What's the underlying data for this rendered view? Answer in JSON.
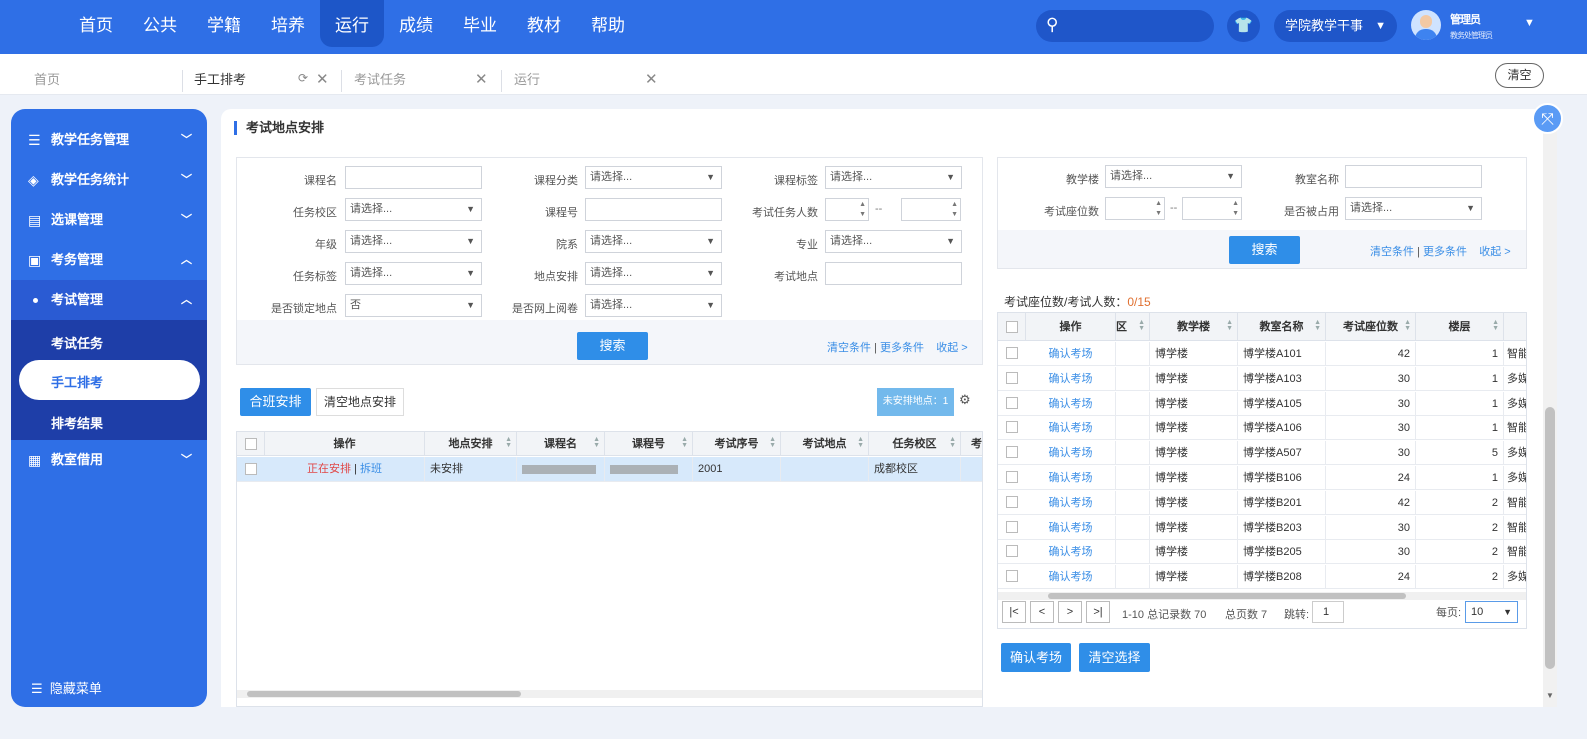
{
  "nav": [
    "首页",
    "公共",
    "学籍",
    "培养",
    "运行",
    "成绩",
    "毕业",
    "教材",
    "帮助"
  ],
  "header": {
    "role": "学院教学干事",
    "user_name": "管理员",
    "user_dept": "教务处管理员"
  },
  "tabs": {
    "t1": "首页",
    "t2": "手工排考",
    "t3": "考试任务",
    "t4": "运行",
    "clear": "清空"
  },
  "sidebar": {
    "m1": "教学任务管理",
    "m2": "教学任务统计",
    "m3": "选课管理",
    "m4": "考务管理",
    "m5": "考试管理",
    "s1": "考试任务",
    "s2": "手工排考",
    "s3": "排考结果",
    "m6": "教室借用",
    "hide": "隐藏菜单"
  },
  "page": {
    "title": "考试地点安排"
  },
  "filter_left": {
    "course_name": "课程名",
    "category": "课程分类",
    "tag": "课程标签",
    "campus": "任务校区",
    "course_no": "课程号",
    "task_count": "考试任务人数",
    "grade": "年级",
    "dept": "院系",
    "major": "专业",
    "task_tag": "任务标签",
    "place_arr": "地点安排",
    "exam_place": "考试地点",
    "locked": "是否锁定地点",
    "online": "是否网上阅卷",
    "placeholder": "请选择...",
    "locked_value": "否",
    "search": "搜索",
    "clear": "清空条件",
    "more": "更多条件",
    "collapse": "收起 >"
  },
  "filter_right": {
    "building": "教学楼",
    "room_name": "教室名称",
    "seats": "考试座位数",
    "occupied": "是否被占用",
    "placeholder": "请选择...",
    "search": "搜索",
    "clear": "清空条件",
    "more": "更多条件",
    "collapse": "收起 >"
  },
  "left_actions": {
    "merge": "合班安排",
    "clear_place": "清空地点安排",
    "unarranged": "未安排地点：1"
  },
  "left_grid": {
    "headers": {
      "op": "操作",
      "place": "地点安排",
      "cname": "课程名",
      "cno": "课程号",
      "seq": "考试序号",
      "loc": "考试地点",
      "campus": "任务校区",
      "more": "考"
    },
    "row": {
      "arranging": "正在安排",
      "sep": "|",
      "split": "拆班",
      "place": "未安排",
      "seq": "2001",
      "campus": "成都校区"
    }
  },
  "right": {
    "ratio_label": "考试座位数/考试人数：",
    "ratio_value": "0/15",
    "headers": {
      "op": "操作",
      "zone": "区",
      "building": "教学楼",
      "room": "教室名称",
      "seats": "考试座位数",
      "floor": "楼层"
    },
    "rows": [
      {
        "op": "确认考场",
        "building": "博学楼",
        "room": "博学楼A101",
        "seats": "42",
        "floor": "1",
        "type": "智能"
      },
      {
        "op": "确认考场",
        "building": "博学楼",
        "room": "博学楼A103",
        "seats": "30",
        "floor": "1",
        "type": "多媒"
      },
      {
        "op": "确认考场",
        "building": "博学楼",
        "room": "博学楼A105",
        "seats": "30",
        "floor": "1",
        "type": "多媒"
      },
      {
        "op": "确认考场",
        "building": "博学楼",
        "room": "博学楼A106",
        "seats": "30",
        "floor": "1",
        "type": "智能"
      },
      {
        "op": "确认考场",
        "building": "博学楼",
        "room": "博学楼A507",
        "seats": "30",
        "floor": "5",
        "type": "多媒"
      },
      {
        "op": "确认考场",
        "building": "博学楼",
        "room": "博学楼B106",
        "seats": "24",
        "floor": "1",
        "type": "多媒"
      },
      {
        "op": "确认考场",
        "building": "博学楼",
        "room": "博学楼B201",
        "seats": "42",
        "floor": "2",
        "type": "智能"
      },
      {
        "op": "确认考场",
        "building": "博学楼",
        "room": "博学楼B203",
        "seats": "30",
        "floor": "2",
        "type": "智能"
      },
      {
        "op": "确认考场",
        "building": "博学楼",
        "room": "博学楼B205",
        "seats": "30",
        "floor": "2",
        "type": "智能"
      },
      {
        "op": "确认考场",
        "building": "博学楼",
        "room": "博学楼B208",
        "seats": "24",
        "floor": "2",
        "type": "多媒"
      }
    ],
    "pager": {
      "range": "1-10 总记录数 70",
      "pages": "总页数 7",
      "jump": "跳转:",
      "jump_value": "1",
      "per_page": "每页:",
      "per_value": "10"
    },
    "confirm": "确认考场",
    "clear_sel": "清空选择"
  }
}
